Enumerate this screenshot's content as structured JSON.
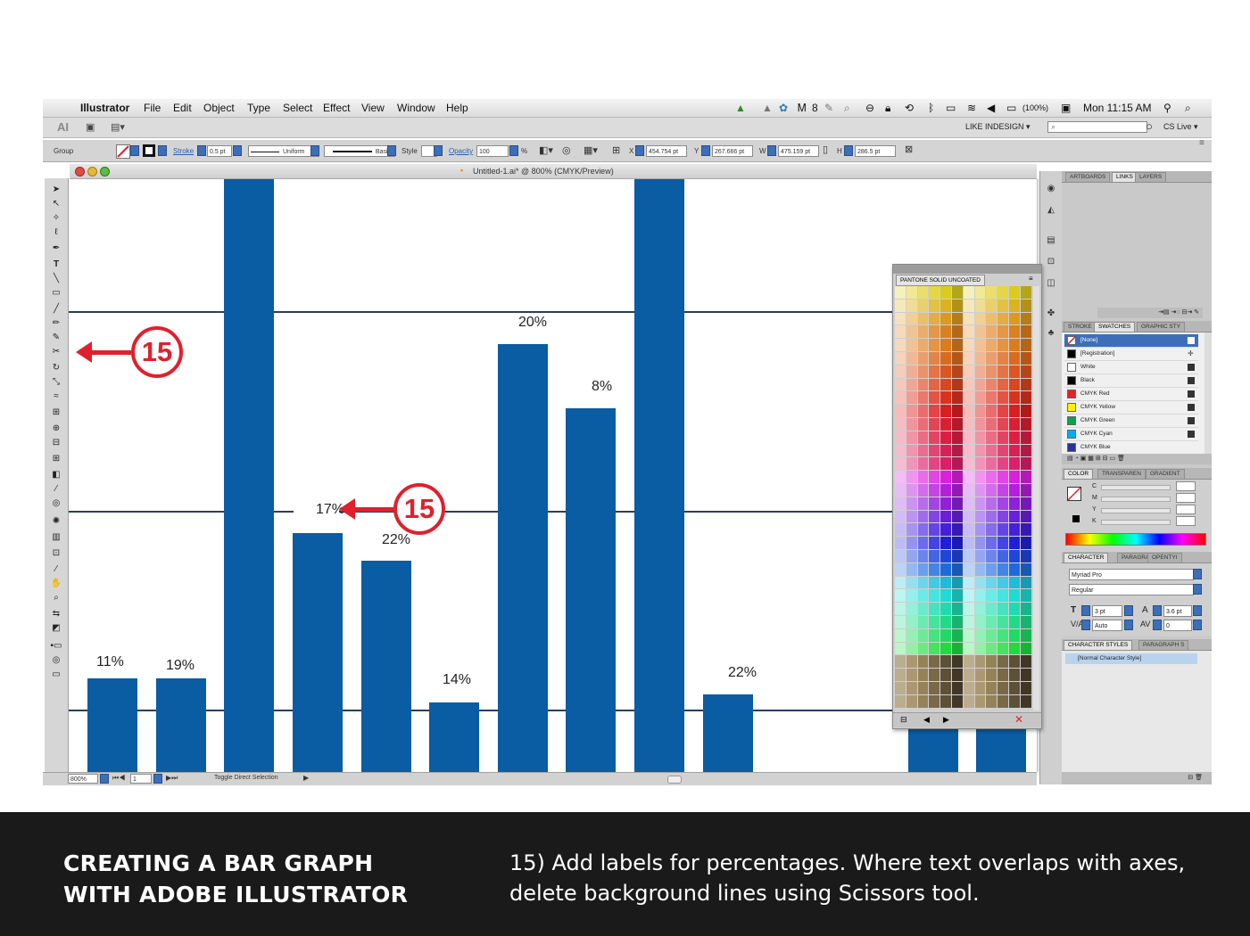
{
  "menubar": {
    "apple_icon": "apple-icon",
    "app_name": "Illustrator",
    "items": [
      "File",
      "Edit",
      "Object",
      "Type",
      "Select",
      "Effect",
      "View",
      "Window",
      "Help"
    ],
    "battery": "(100%)",
    "clock": "Mon 11:15 AM",
    "badge": "8"
  },
  "appbar": {
    "logo": "AI",
    "workspace": "LIKE INDESIGN ▾",
    "cs_live": "CS Live ▾"
  },
  "control_bar": {
    "selection_type": "Group",
    "stroke_label": "Stroke",
    "stroke_value": "0.5 pt",
    "stroke_profile": "Uniform",
    "brush": "Basic",
    "style_label": "Style",
    "opacity_label": "Opacity",
    "opacity_value": "100",
    "opacity_unit": "%",
    "x_label": "X",
    "x_value": "454.754 pt",
    "y_label": "Y",
    "y_value": "267.666 pt",
    "w_label": "W",
    "w_value": "475.159 pt",
    "h_label": "H",
    "h_value": "286.5 pt"
  },
  "document": {
    "title": "Untitled-1.ai* @ 800% (CMYK/Preview)",
    "zoom": "800%",
    "page": "1",
    "status": "Toggle Direct Selection"
  },
  "chart_data": {
    "type": "bar",
    "values": [
      11,
      19,
      null,
      17,
      22,
      14,
      20,
      8,
      null,
      22
    ],
    "labels": [
      "11%",
      "19%",
      "",
      "17%",
      "22%",
      "14%",
      "20%",
      "8%",
      "",
      "22%"
    ]
  },
  "callouts": [
    "15",
    "15"
  ],
  "panels": {
    "top_tabs": [
      "ARTBOARDS",
      "LINKS",
      "LAYERS"
    ],
    "swatch_tabs": [
      "STROKE",
      "SWATCHES",
      "GRAPHIC STY"
    ],
    "swatches": [
      {
        "name": "[None]",
        "color": "#ffffff"
      },
      {
        "name": "[Registration]",
        "color": "#000000"
      },
      {
        "name": "White",
        "color": "#ffffff"
      },
      {
        "name": "Black",
        "color": "#000000"
      },
      {
        "name": "CMYK Red",
        "color": "#e8202a"
      },
      {
        "name": "CMYK Yellow",
        "color": "#fff200"
      },
      {
        "name": "CMYK Green",
        "color": "#00a651"
      },
      {
        "name": "CMYK Cyan",
        "color": "#00aeef"
      },
      {
        "name": "CMYK Blue",
        "color": "#2e3192"
      }
    ],
    "color_tabs": [
      "COLOR",
      "TRANSPAREN",
      "GRADIENT"
    ],
    "cmyk_labels": [
      "C",
      "M",
      "Y",
      "K"
    ],
    "character_tabs": [
      "CHARACTER",
      "PARAGRA",
      "OPENTYI"
    ],
    "font_family": "Myriad Pro",
    "font_style": "Regular",
    "font_size": "3 pt",
    "leading": "3.6 pt",
    "kerning": "Auto",
    "tracking": "0",
    "char_style_tabs": [
      "CHARACTER STYLES",
      "PARAGRAPH S"
    ],
    "char_style_item": "[Normal Character Style]",
    "pantone_title": "PANTONE SOLID UNCOATED"
  },
  "footer": {
    "title_line1": "CREATING A BAR GRAPH",
    "title_line2": "WITH ADOBE ILLUSTRATOR",
    "text_line1": "15) Add labels for percentages. Where text overlaps with axes,",
    "text_line2": "delete background lines using Scissors tool."
  },
  "colors": {
    "bar": "#0a5ca3",
    "callout": "#e0202c",
    "footer_bg": "#1a1a1a"
  }
}
